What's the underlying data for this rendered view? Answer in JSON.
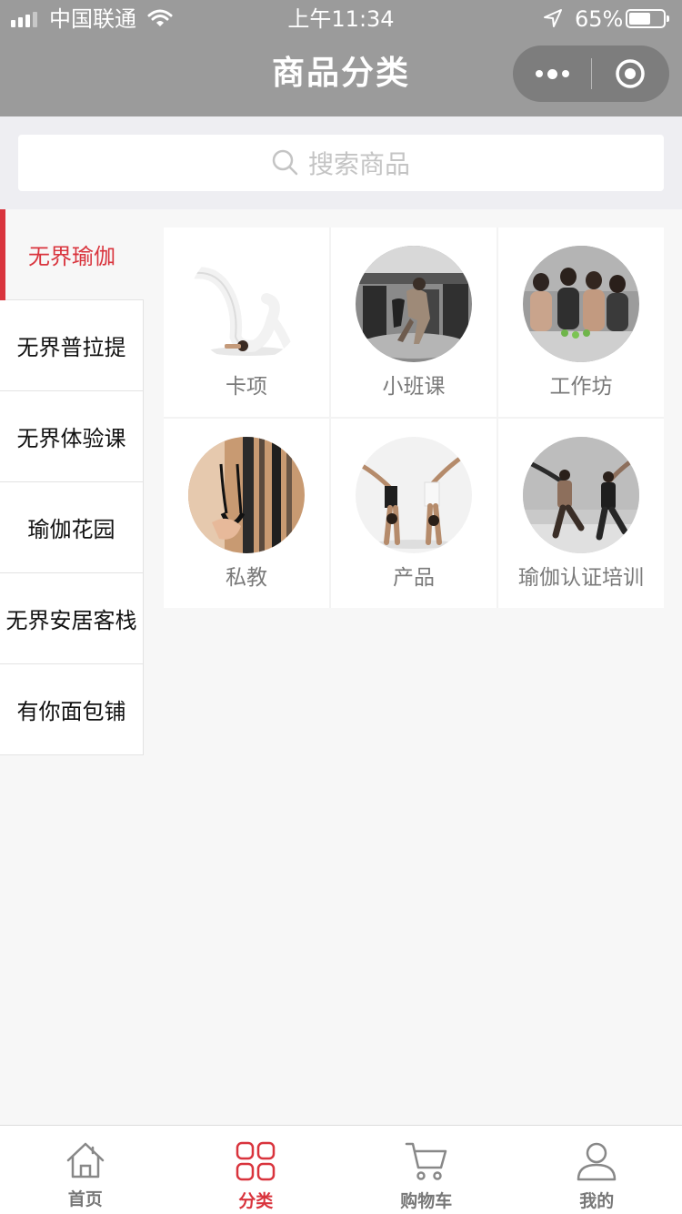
{
  "status_bar": {
    "carrier": "中国联通",
    "time": "上午11:34",
    "battery_percent": "65%",
    "battery_level": 0.65
  },
  "nav": {
    "title": "商品分类"
  },
  "search": {
    "placeholder": "搜索商品"
  },
  "sidebar": {
    "items": [
      {
        "label": "无界瑜伽",
        "active": true
      },
      {
        "label": "无界普拉提"
      },
      {
        "label": "无界体验课"
      },
      {
        "label": "瑜伽花园"
      },
      {
        "label": "无界安居客栈"
      },
      {
        "label": "有你面包铺"
      }
    ]
  },
  "grid": {
    "items": [
      {
        "label": "卡项"
      },
      {
        "label": "小班课"
      },
      {
        "label": "工作坊"
      },
      {
        "label": "私教"
      },
      {
        "label": "产品"
      },
      {
        "label": "瑜伽认证培训"
      }
    ]
  },
  "tabbar": {
    "items": [
      {
        "label": "首页",
        "icon": "home-icon"
      },
      {
        "label": "分类",
        "icon": "category-icon",
        "active": true
      },
      {
        "label": "购物车",
        "icon": "cart-icon"
      },
      {
        "label": "我的",
        "icon": "user-icon"
      }
    ]
  },
  "colors": {
    "accent": "#d9343d",
    "header": "#9b9b9b"
  }
}
